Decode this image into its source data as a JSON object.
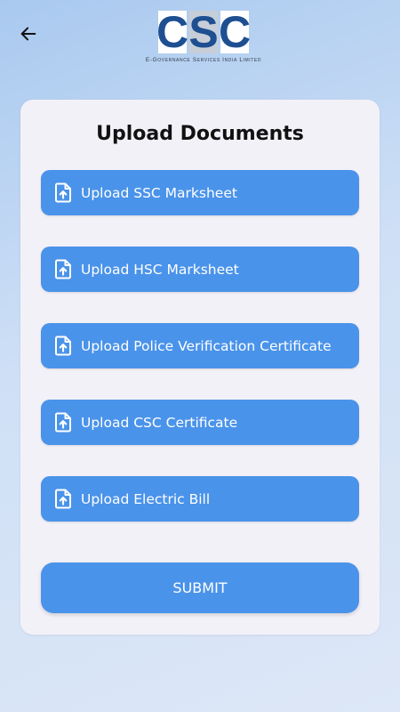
{
  "header": {
    "back_icon": "arrow-left-icon",
    "logo": {
      "letters": [
        "C",
        "S",
        "C"
      ],
      "tagline": "E-Governance Services India Limited"
    }
  },
  "card": {
    "title": "Upload Documents",
    "uploads": [
      {
        "label": "Upload SSC Marksheet",
        "icon": "file-upload-icon"
      },
      {
        "label": "Upload HSC Marksheet",
        "icon": "file-upload-icon"
      },
      {
        "label": "Upload Police Verification Certificate",
        "icon": "file-upload-icon"
      },
      {
        "label": "Upload CSC Certificate",
        "icon": "file-upload-icon"
      },
      {
        "label": "Upload Electric Bill",
        "icon": "file-upload-icon"
      }
    ],
    "submit_label": "SUBMIT"
  },
  "colors": {
    "button": "#4a93ea",
    "card_background": "#f3f1f8",
    "logo_blue": "#1d4f91"
  }
}
